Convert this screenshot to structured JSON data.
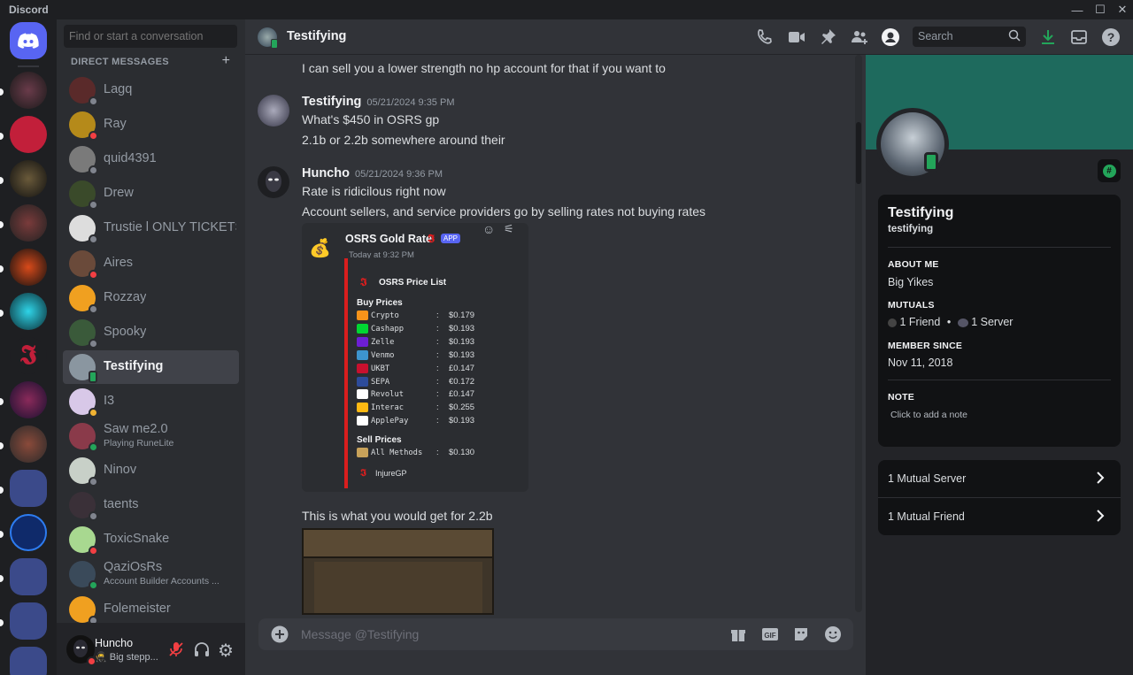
{
  "app": {
    "title": "Discord"
  },
  "colors": {
    "accent": "#5865f2",
    "online": "#23a55a",
    "dnd": "#f23f43",
    "idle": "#f0b232",
    "offline": "#80848e",
    "banner": "#1e6a5d",
    "embed_bar": "#da1e1e"
  },
  "dm_list": {
    "search_placeholder": "Find or start a conversation",
    "header": "DIRECT MESSAGES",
    "items": [
      {
        "name": "Lagq",
        "sub": "",
        "status": "offline"
      },
      {
        "name": "Ray",
        "sub": "",
        "status": "dnd"
      },
      {
        "name": "quid4391",
        "sub": "",
        "status": "offline"
      },
      {
        "name": "Drew",
        "sub": "",
        "status": "offline"
      },
      {
        "name": "Trustie l ONLY TICKETS",
        "sub": "",
        "status": "offline"
      },
      {
        "name": "Aires",
        "sub": "",
        "status": "dnd"
      },
      {
        "name": "Rozzay",
        "sub": "",
        "status": "offline"
      },
      {
        "name": "Spooky",
        "sub": "",
        "status": "offline"
      },
      {
        "name": "Testifying",
        "sub": "",
        "status": "online-mobile"
      },
      {
        "name": "I3",
        "sub": "",
        "status": "idle"
      },
      {
        "name": "Saw me2.0",
        "sub": "Playing RuneLite",
        "status": "online"
      },
      {
        "name": "Ninov",
        "sub": "",
        "status": "offline"
      },
      {
        "name": "taents",
        "sub": "",
        "status": "offline"
      },
      {
        "name": "ToxicSnake",
        "sub": "",
        "status": "dnd"
      },
      {
        "name": "QaziOsRs",
        "sub": "Account Builder Accounts ...",
        "status": "online"
      },
      {
        "name": "Folemeister",
        "sub": "",
        "status": "offline"
      }
    ]
  },
  "user_bar": {
    "name": "Huncho",
    "status_text": "Big stepp..."
  },
  "header": {
    "title": "Testifying",
    "search_placeholder": "Search"
  },
  "messages": {
    "m0_text": "I can sell you a lower strength no hp account for that if you want to",
    "m1_author": "Testifying",
    "m1_time": "05/21/2024 9:35 PM",
    "m1_l1": "What's $450 in OSRS gp",
    "m1_l2": "2.1b or 2.2b somewhere around their",
    "m2_author": "Huncho",
    "m2_time": "05/21/2024 9:36 PM",
    "m2_l1": "Rate is ridicilous right now",
    "m2_l2": "Account sellers, and service providers go by selling rates not buying rates",
    "m3_text": "This is what you would get for 2.2b"
  },
  "embed": {
    "bot": "OSRS Gold Rate",
    "badge": "APP",
    "time": "Today at 9:32 PM",
    "title": "OSRS Price List",
    "buy_header": "Buy Prices",
    "sell_header": "Sell Prices",
    "buy": [
      {
        "method": "Crypto",
        "price": "$0.179",
        "color": "#f7931a"
      },
      {
        "method": "Cashapp",
        "price": "$0.193",
        "color": "#00d632"
      },
      {
        "method": "Zelle",
        "price": "$0.193",
        "color": "#6d1ed4"
      },
      {
        "method": "Venmo",
        "price": "$0.193",
        "color": "#3d95ce"
      },
      {
        "method": "UKBT",
        "price": "£0.147",
        "color": "#c8102e"
      },
      {
        "method": "SEPA",
        "price": "€0.172",
        "color": "#2d4b9a"
      },
      {
        "method": "Revolut",
        "price": "£0.147",
        "color": "#ffffff"
      },
      {
        "method": "Interac",
        "price": "$0.255",
        "color": "#fdb913"
      },
      {
        "method": "ApplePay",
        "price": "$0.193",
        "color": "#ffffff"
      }
    ],
    "sell": [
      {
        "method": "All Methods",
        "price": "$0.130",
        "color": "#c8a25a"
      }
    ],
    "footer": "InjureGP",
    "colon": ":"
  },
  "composer": {
    "placeholder": "Message @Testifying"
  },
  "profile": {
    "display_name": "Testifying",
    "username": "testifying",
    "about_h": "ABOUT ME",
    "about": "Big Yikes",
    "mutuals_h": "MUTUALS",
    "mutual_friend": "1 Friend",
    "dot": "•",
    "mutual_server": "1 Server",
    "since_h": "MEMBER SINCE",
    "since": "Nov 11, 2018",
    "note_h": "NOTE",
    "note_placeholder": "Click to add a note",
    "row1": "1 Mutual Server",
    "row2": "1 Mutual Friend"
  }
}
